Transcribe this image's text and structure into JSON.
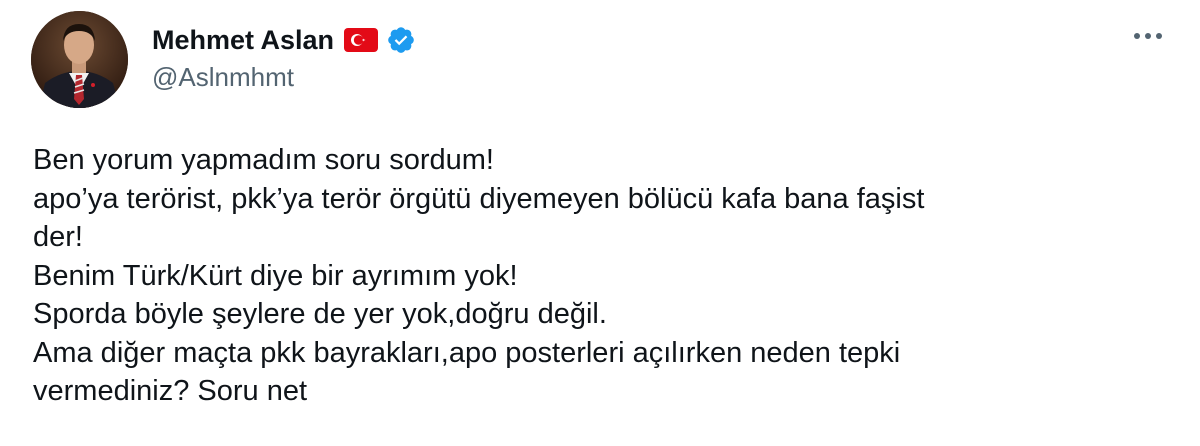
{
  "author": {
    "display_name": "Mehmet Aslan",
    "handle": "@Aslnmhmt",
    "flag_icon": "turkey-flag-icon",
    "verified_icon": "verified-badge-icon",
    "verified_color": "#1d9bf0",
    "flag_color": "#e30a17"
  },
  "more_menu": {
    "icon": "more-options-icon"
  },
  "tweet": {
    "lines": [
      "Ben yorum yapmadım soru sordum!",
      "apo’ya terörist, pkk’ya terör örgütü diyemeyen bölücü kafa bana faşist",
      "der!",
      "Benim Türk/Kürt diye bir ayrımım yok!",
      "Sporda böyle şeylere de yer yok,doğru değil.",
      "Ama diğer maçta pkk bayrakları,apo posterleri açılırken neden tepki",
      "vermediniz? Soru net"
    ]
  },
  "colors": {
    "text_primary": "#0f1419",
    "text_secondary": "#536471",
    "background": "#ffffff"
  }
}
